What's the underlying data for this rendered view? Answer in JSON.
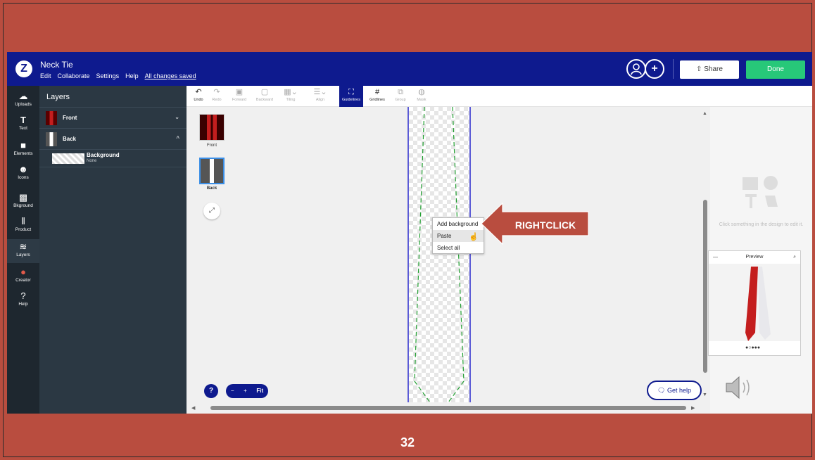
{
  "topbar": {
    "doc_title": "Neck Tie",
    "menu": [
      "Edit",
      "Collaborate",
      "Settings",
      "Help"
    ],
    "saved_status": "All changes saved",
    "share_label": "Share",
    "done_label": "Done"
  },
  "leftnav": [
    {
      "label": "Uploads",
      "icon": "cloud-upload-icon"
    },
    {
      "label": "Text",
      "icon": "text-icon"
    },
    {
      "label": "Elements",
      "icon": "elements-icon"
    },
    {
      "label": "Icons",
      "icon": "smiley-icon"
    },
    {
      "label": "Bkground",
      "icon": "background-icon"
    },
    {
      "label": "Product",
      "icon": "product-icon"
    },
    {
      "label": "Layers",
      "icon": "layers-icon"
    },
    {
      "label": "Creator",
      "icon": "creator-icon"
    },
    {
      "label": "Help",
      "icon": "help-icon"
    }
  ],
  "layers": {
    "title": "Layers",
    "items": [
      {
        "label": "Front"
      },
      {
        "label": "Back"
      }
    ],
    "background": {
      "label": "Background",
      "value": "None"
    }
  },
  "toolbar": [
    "Undo",
    "Redo",
    "Forward",
    "Backward",
    "Tiling",
    "Align",
    "Guidelines",
    "Gridlines",
    "Group",
    "Mask"
  ],
  "pages": [
    {
      "label": "Front"
    },
    {
      "label": "Back"
    }
  ],
  "context_menu": [
    "Add background",
    "Paste",
    "Select all"
  ],
  "annotation": "RIGHTCLICK",
  "right_panel": {
    "hint": "Click something in the design to edit it.",
    "preview_title": "Preview"
  },
  "bottom": {
    "help": "?",
    "zoom_minus": "−",
    "zoom_plus": "+",
    "zoom_fit": "Fit",
    "get_help": "Get help"
  },
  "slide_number": "32",
  "colors": {
    "slide_bg": "#b94d3f",
    "topbar": "#0e1a8e",
    "done": "#27c879",
    "panel": "#2b3843"
  }
}
